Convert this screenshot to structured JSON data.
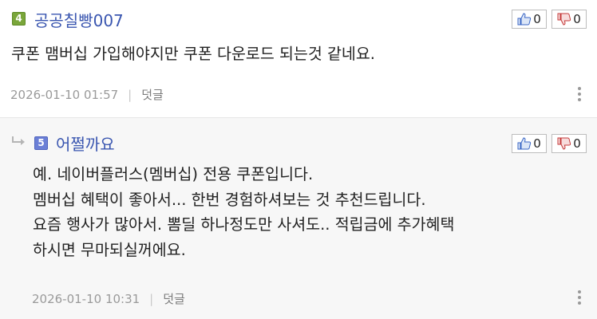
{
  "comments": [
    {
      "level": "4",
      "nickname": "공공칠빵007",
      "likes": "0",
      "dislikes": "0",
      "body": "쿠폰 맴버십 가입해야지만 쿠폰 다운로드 되는것 같네요.",
      "date": "2026-01-10 01:57",
      "reply_label": "덧글"
    },
    {
      "level": "5",
      "nickname": "어쩔까요",
      "likes": "0",
      "dislikes": "0",
      "body": "예. 네이버플러스(멤버십) 전용 쿠폰입니다.\n멤버십 혜택이 좋아서... 한번 경험하셔보는 것 추천드립니다.\n요즘 행사가 많아서. 뽐딜 하나정도만 사셔도.. 적립금에 추가혜택\n하시면 무마되실꺼에요.",
      "date": "2026-01-10 10:31",
      "reply_label": "덧글"
    }
  ],
  "colors": {
    "nickname": "#3a56b0",
    "level4": "#7aa63a",
    "level5": "#6b7fd6",
    "reply_bg": "#f7f7f7"
  },
  "icons": {
    "like": "thumbs-up-icon",
    "dislike": "thumbs-down-icon",
    "more": "kebab-menu-icon",
    "reply": "reply-arrow-icon"
  }
}
